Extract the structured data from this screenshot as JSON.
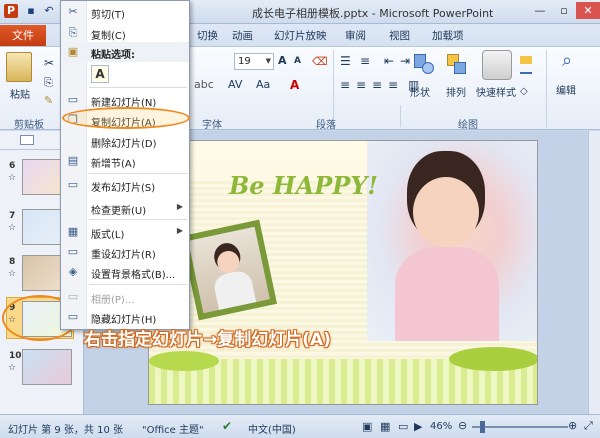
{
  "window": {
    "title": "宝宝成长电子相册模板.pptx - Microsoft PowerPoint",
    "title_visible": "成长电子相册模板.pptx - Microsoft PowerPoint"
  },
  "quick_access": {
    "app_icon": "P",
    "save_icon": "save-icon",
    "undo_icon": "undo-icon"
  },
  "ribbon": {
    "file_tab": "文件",
    "tabs": [
      "切换",
      "动画",
      "幻灯片放映",
      "审阅",
      "视图",
      "加载项"
    ],
    "font_size_value": "19",
    "groups": {
      "clipboard": "剪贴板",
      "font": "字体",
      "paragraph": "段落",
      "drawing": "绘图"
    },
    "buttons": {
      "paste": "粘贴",
      "shapes": "形状",
      "arrange": "排列",
      "quick_styles": "快速样式",
      "editing": "编辑"
    }
  },
  "context_menu": {
    "items": [
      {
        "label": "剪切(T)",
        "icon": "✂"
      },
      {
        "label": "复制(C)",
        "icon": "⎘"
      },
      {
        "label": "粘贴选项:",
        "icon": "📋"
      },
      {
        "label": "A",
        "icon": ""
      },
      {
        "label": "新建幻灯片(N)",
        "icon": "▭"
      },
      {
        "label": "复制幻灯片(A)",
        "icon": "▭"
      },
      {
        "label": "删除幻灯片(D)",
        "icon": ""
      },
      {
        "label": "新增节(A)",
        "icon": "▤"
      },
      {
        "label": "发布幻灯片(S)",
        "icon": "▭"
      },
      {
        "label": "检查更新(U)",
        "icon": ""
      },
      {
        "label": "版式(L)",
        "icon": "▦"
      },
      {
        "label": "重设幻灯片(R)",
        "icon": "▭"
      },
      {
        "label": "设置背景格式(B)...",
        "icon": "◈"
      },
      {
        "label": "相册(P)...",
        "icon": "▭"
      },
      {
        "label": "隐藏幻灯片(H)",
        "icon": "▭"
      }
    ]
  },
  "slides_pane": {
    "numbers": [
      "6",
      "7",
      "8",
      "9",
      "10"
    ],
    "star": "☆"
  },
  "slide": {
    "headline": "Be HAPPY!"
  },
  "annotation": "右击指定幻灯片→复制幻灯片(A)",
  "status_bar": {
    "slide_info": "幻灯片 第 9 张，共 10 张",
    "theme": "\"Office 主题\"",
    "language": "中文(中国)",
    "zoom": "46%"
  }
}
